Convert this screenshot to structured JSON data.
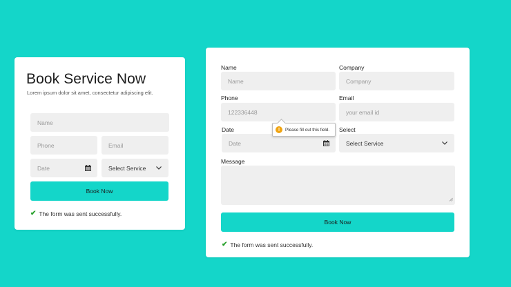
{
  "left_form": {
    "title": "Book Service Now",
    "subtitle": "Lorem ipsum dolor sit amet, consectetur adipiscing elit.",
    "name_placeholder": "Name",
    "phone_placeholder": "Phone",
    "email_placeholder": "Email",
    "date_placeholder": "Date",
    "service_select": "Select Service",
    "submit_label": "Book Now",
    "success_message": "The form was sent successfully."
  },
  "right_form": {
    "name_label": "Name",
    "name_placeholder": "Name",
    "company_label": "Company",
    "company_placeholder": "Company",
    "phone_label": "Phone",
    "phone_value": "122336448",
    "email_label": "Email",
    "email_placeholder": "your email id",
    "date_label": "Date",
    "date_placeholder": "Date",
    "select_label": "Select",
    "service_select": "Select Service",
    "message_label": "Message",
    "submit_label": "Book Now",
    "success_message": "The form was sent successfully.",
    "validation_tooltip": "Please fill out this field."
  },
  "colors": {
    "background": "#14d6c9",
    "button": "#14d6c9",
    "field": "#efefef",
    "success_check": "#27a02b",
    "warning": "#f0a412"
  },
  "icons": {
    "calendar": "calendar-icon",
    "chevron": "chevron-down-icon",
    "check": "check-icon",
    "warning": "warning-icon"
  }
}
